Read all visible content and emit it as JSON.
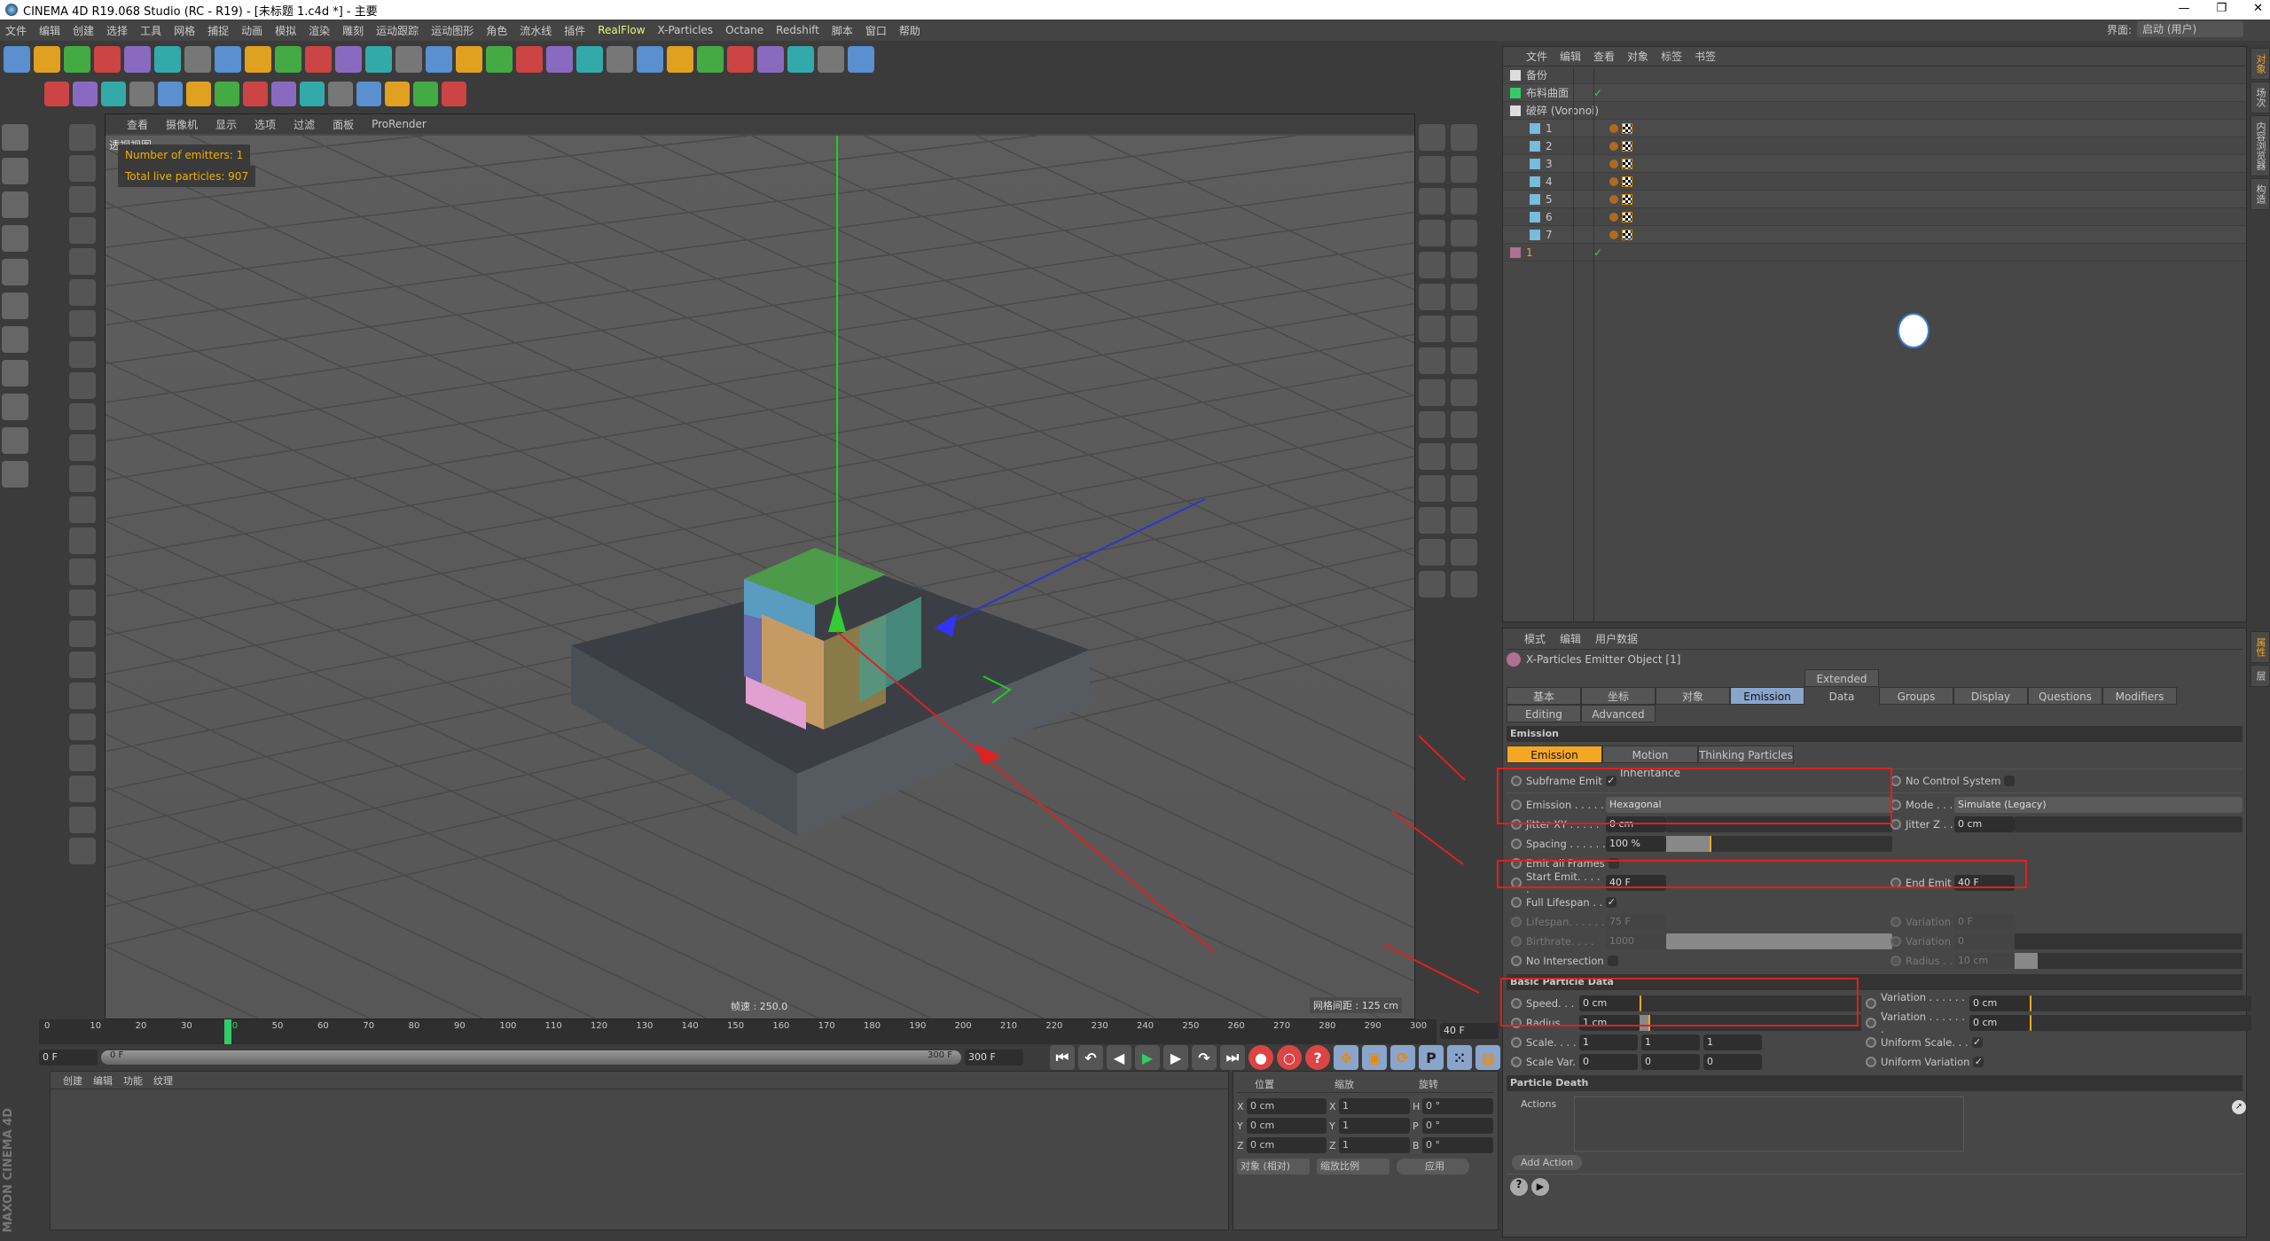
{
  "window": {
    "title": "CINEMA 4D R19.068 Studio (RC - R19) - [未标题 1.c4d *] - 主要",
    "controls": [
      "—",
      "❐",
      "✕"
    ]
  },
  "menu": [
    "文件",
    "编辑",
    "创建",
    "选择",
    "工具",
    "网格",
    "捕捉",
    "动画",
    "模拟",
    "渲染",
    "雕刻",
    "运动跟踪",
    "运动图形",
    "角色",
    "流水线",
    "插件",
    "RealFlow",
    "X-Particles",
    "Octane",
    "Redshift",
    "脚本",
    "窗口",
    "帮助"
  ],
  "menu_highlight": "RealFlow",
  "layout": {
    "label": "界面:",
    "value": "启动 (用户)"
  },
  "toolbar_row1": [
    "undo",
    "redo",
    "select",
    "move",
    "scale",
    "rotate",
    "add",
    "X",
    "Y",
    "Z",
    "coord",
    "render-view",
    "render",
    "render-settings",
    "cube",
    "pen",
    "subdivide",
    "array",
    "spline-mask",
    "plane",
    "camera",
    "light",
    "S",
    "boole",
    "connect",
    "deformer",
    "sphere",
    "sculpt",
    "psr"
  ],
  "toolbar_row2": [
    "polygon",
    "points",
    "knife",
    "brush",
    "lasso",
    "particles",
    "emitter",
    "flow",
    "vortex",
    "emitter2",
    "text",
    "cube2",
    "cloner",
    "pipe",
    "fx"
  ],
  "viewport": {
    "menu": [
      "查看",
      "摄像机",
      "显示",
      "选项",
      "过滤",
      "面板",
      "ProRender"
    ],
    "label": "透视视图",
    "hud": [
      "Number of emitters: 1",
      "Total live particles: 907"
    ],
    "fps": "帧速 : 250.0",
    "grid": "网格间距 : 125 cm"
  },
  "object_manager": {
    "menu": [
      "文件",
      "编辑",
      "查看",
      "对象",
      "标签",
      "书签"
    ],
    "objects": [
      {
        "name": "备份",
        "icon": "null-icon",
        "depth": 0
      },
      {
        "name": "布料曲面",
        "icon": "cloth-surface-icon",
        "depth": 0,
        "check": "✓"
      },
      {
        "name": "破碎 (Voronoi)",
        "icon": "null-icon",
        "depth": 0
      },
      {
        "name": "1",
        "icon": "cone-icon",
        "depth": 1
      },
      {
        "name": "2",
        "icon": "cone-icon",
        "depth": 1
      },
      {
        "name": "3",
        "icon": "cone-icon",
        "depth": 1
      },
      {
        "name": "4",
        "icon": "cone-icon",
        "depth": 1
      },
      {
        "name": "5",
        "icon": "cone-icon",
        "depth": 1
      },
      {
        "name": "6",
        "icon": "cone-icon",
        "depth": 1
      },
      {
        "name": "7",
        "icon": "cone-icon",
        "depth": 1
      },
      {
        "name": "1",
        "icon": "xp-emitter-icon",
        "depth": 0,
        "check": "✓",
        "selected": true
      }
    ],
    "side_tabs": [
      "对象",
      "场次",
      "内容浏览器",
      "构造"
    ]
  },
  "attributes": {
    "menu": [
      "模式",
      "编辑",
      "用户数据"
    ],
    "object_title": "X-Particles Emitter Object [1]",
    "tabs_row1": [
      "基本",
      "坐标",
      "对象",
      "Emission",
      "Extended Data",
      "Groups",
      "Display",
      "Questions",
      "Modifiers"
    ],
    "tabs_row2": [
      "Editing",
      "Advanced"
    ],
    "active_tab": "Emission",
    "section_emission": "Emission",
    "subtabs": [
      "Emission",
      "Motion Inheritance",
      "Thinking Particles"
    ],
    "subframe_emit": "Subframe Emit",
    "no_control": "No Control System",
    "emission_label": "Emission . . . . .",
    "emission_value": "Hexagonal",
    "mode_label": "Mode . . .",
    "mode_value": "Simulate (Legacy)",
    "jitter_xy_label": "Jitter XY . . . . .",
    "jitter_xy": "0 cm",
    "jitter_z_label": "Jitter Z . .",
    "jitter_z": "0 cm",
    "spacing_label": "Spacing . . . . . .",
    "spacing": "100 %",
    "spacing_fill": 0.2,
    "emit_all": "Emit all Frames",
    "start_emit_label": "Start Emit. . . . .",
    "start_emit": "40 F",
    "end_emit_label": "End Emit",
    "end_emit": "40 F",
    "full_lifespan": "Full Lifespan . .",
    "lifespan_label": "Lifespan. . . . . .",
    "lifespan": "75 F",
    "variation_label": "Variation",
    "lifespan_var": "0 F",
    "birthrate_label": "Birthrate. . . .",
    "birthrate": "1000",
    "birthrate_var": "0",
    "no_intersection": "No Intersection",
    "radius_label2": "Radius . .",
    "no_int_radius": "10 cm",
    "section_basic": "Basic Particle Data",
    "speed_label": "Speed. . .",
    "speed": "0 cm",
    "radius_label": "Radius . .",
    "radius": "1 cm",
    "var_label": "Variation . . . . . . .",
    "speed_var": "0 cm",
    "radius_var": "0 cm",
    "scale_label": "Scale. . . .",
    "scale": [
      "1",
      "1",
      "1"
    ],
    "scalevar_label": "Scale Var.",
    "scale_var": [
      "0",
      "0",
      "0"
    ],
    "uniform_scale": "Uniform Scale. . .",
    "uniform_variation": "Uniform Variation",
    "section_death": "Particle Death",
    "actions_label": "Actions",
    "add_action": "Add Action",
    "side_tabs": [
      "属性",
      "层"
    ]
  },
  "timeline": {
    "ticks": [
      "0",
      "10",
      "20",
      "30",
      "40",
      "50",
      "60",
      "70",
      "80",
      "90",
      "100",
      "110",
      "120",
      "130",
      "140",
      "150",
      "160",
      "170",
      "180",
      "190",
      "200",
      "210",
      "220",
      "230",
      "240",
      "250",
      "260",
      "270",
      "280",
      "290",
      "300"
    ],
    "current": "40 F",
    "current_frame": 40,
    "start": "0 F",
    "range_start": "0 F",
    "range_end": "300 F",
    "end": "300 F"
  },
  "material_manager": {
    "menu": [
      "创建",
      "编辑",
      "功能",
      "纹理"
    ]
  },
  "coordinates": {
    "headers": [
      "位置",
      "缩放",
      "旋转"
    ],
    "rows": [
      {
        "a": "X",
        "pos": "0 cm",
        "b": "X",
        "scale": "1",
        "c": "H",
        "rot": "0 °"
      },
      {
        "a": "Y",
        "pos": "0 cm",
        "b": "Y",
        "scale": "1",
        "c": "P",
        "rot": "0 °"
      },
      {
        "a": "Z",
        "pos": "0 cm",
        "b": "Z",
        "scale": "1",
        "c": "B",
        "rot": "0 °"
      }
    ],
    "mode": "对象 (相对)",
    "scale_mode": "缩放比例",
    "apply": "应用"
  },
  "brand": "MAXON CINEMA 4D",
  "colors": {
    "accent": "#f5a623",
    "active_tab": "#8aa5cc",
    "annotation": "#e02020"
  }
}
